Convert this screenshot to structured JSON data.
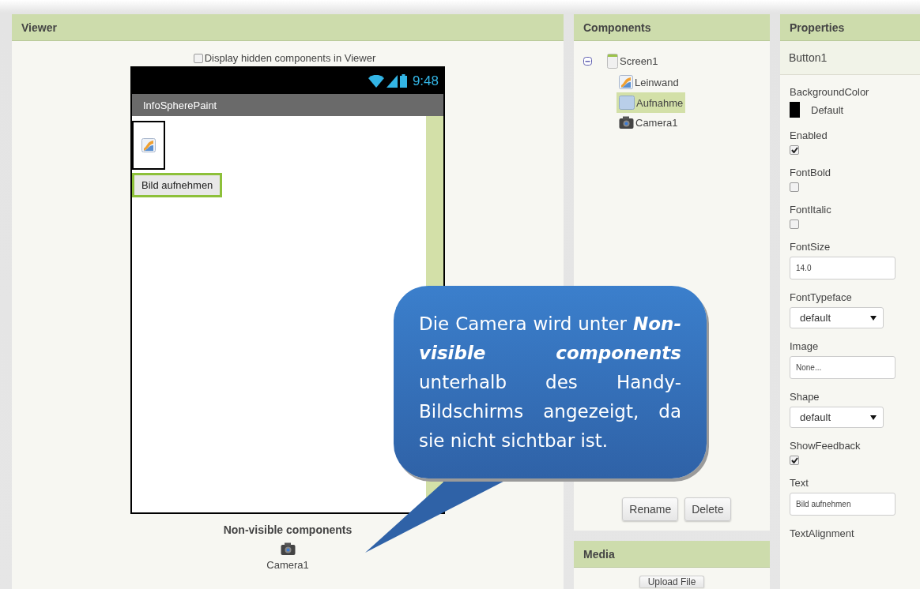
{
  "viewer": {
    "title": "Viewer",
    "hidden_toggle": {
      "label": "Display hidden components in Viewer",
      "checked": false
    },
    "phone": {
      "time": "9:48",
      "app_title": "InfoSpherePaint",
      "button_label": "Bild aufnehmen"
    },
    "nonvisible": {
      "title": "Non-visible components",
      "items": [
        {
          "label": "Camera1"
        }
      ]
    }
  },
  "components": {
    "title": "Components",
    "tree": [
      {
        "label": "Screen1",
        "kind": "screen",
        "expanded": true,
        "selected": false,
        "children": [
          {
            "label": "Leinwand",
            "kind": "canvas",
            "selected": false
          },
          {
            "label": "Aufnahme",
            "kind": "button",
            "selected": true
          },
          {
            "label": "Camera1",
            "kind": "camera",
            "selected": false
          }
        ]
      }
    ],
    "buttons": [
      "Rename",
      "Delete"
    ]
  },
  "media": {
    "title": "Media",
    "button": "Upload File"
  },
  "properties": {
    "title": "Properties",
    "component": "Button1",
    "items": [
      {
        "kind": "color",
        "label": "BackgroundColor",
        "value": "Default",
        "color": "#000000"
      },
      {
        "kind": "checkbox",
        "label": "Enabled",
        "checked": true
      },
      {
        "kind": "checkbox",
        "label": "FontBold",
        "checked": false
      },
      {
        "kind": "checkbox",
        "label": "FontItalic",
        "checked": false
      },
      {
        "kind": "text",
        "label": "FontSize",
        "value": "14.0"
      },
      {
        "kind": "select",
        "label": "FontTypeface",
        "value": "default"
      },
      {
        "kind": "text",
        "label": "Image",
        "value": "None..."
      },
      {
        "kind": "select",
        "label": "Shape",
        "value": "default"
      },
      {
        "kind": "checkbox",
        "label": "ShowFeedback",
        "checked": true
      },
      {
        "kind": "text",
        "label": "Text",
        "value": "Bild aufnehmen"
      },
      {
        "kind": "heading",
        "label": "TextAlignment"
      }
    ]
  },
  "callout": {
    "text": "Die Camera wird unter **Non-visible components** unterhalb des Handy-Bildschirms angezeigt, da sie nicht sichtbar ist."
  }
}
